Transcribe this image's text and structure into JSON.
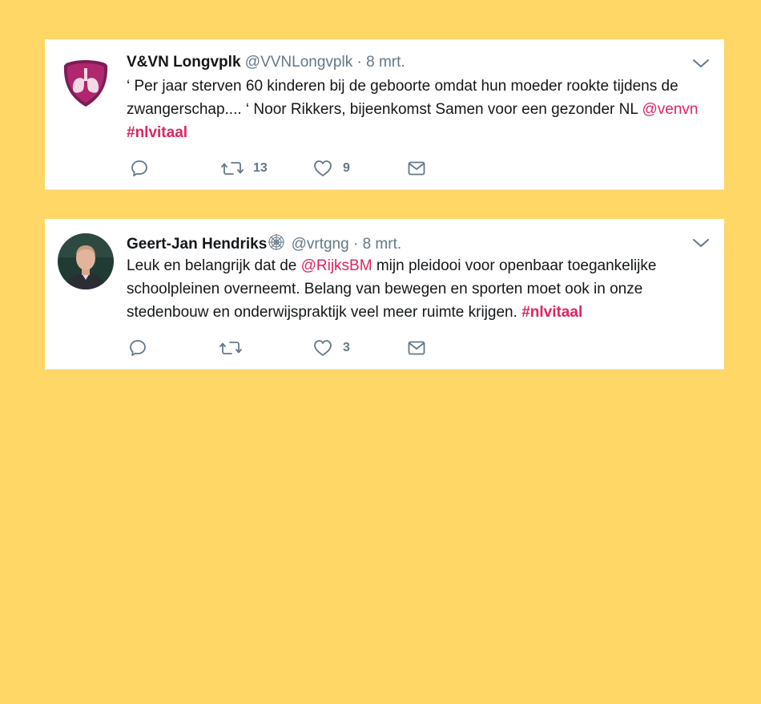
{
  "tweets": [
    {
      "name": "V&VN Longvplk",
      "handle": "@VVNLongvplk",
      "separator": "·",
      "date": "8 mrt.",
      "text_part1": "‘ Per jaar sterven 60 kinderen bij de geboorte omdat hun moeder rookte tijdens de zwangerschap.... ‘ Noor Rikkers, bijeenkomst Samen voor een gezonder NL ",
      "mention": "@venvn",
      "text_part2": " ",
      "hashtag": "#nlvitaal",
      "reply_count": "",
      "retweet_count": "13",
      "like_count": "9",
      "avatar_icon": "lungs-shield-icon",
      "brand_color": "#8b1a5c"
    },
    {
      "name": "Geert-Jan Hendriks",
      "badge_icon": "spiderweb-icon",
      "handle": "@vrtgng",
      "separator": "·",
      "date": "8 mrt.",
      "text_part1": "Leuk en belangrijk dat de ",
      "mention": "@RijksBM",
      "text_part2": " mijn pleidooi voor openbaar toegankelijke schoolpleinen overneemt. Belang van bewegen en sporten moet ook in onze stedenbouw en onderwijspraktijk veel meer ruimte krijgen. ",
      "hashtag": "#nlvitaal",
      "reply_count": "",
      "retweet_count": "",
      "like_count": "3",
      "avatar_icon": "profile-photo"
    }
  ],
  "colors": {
    "background": "#FFD767",
    "link": "#e0245e",
    "muted": "#657786",
    "text": "#14171a"
  }
}
